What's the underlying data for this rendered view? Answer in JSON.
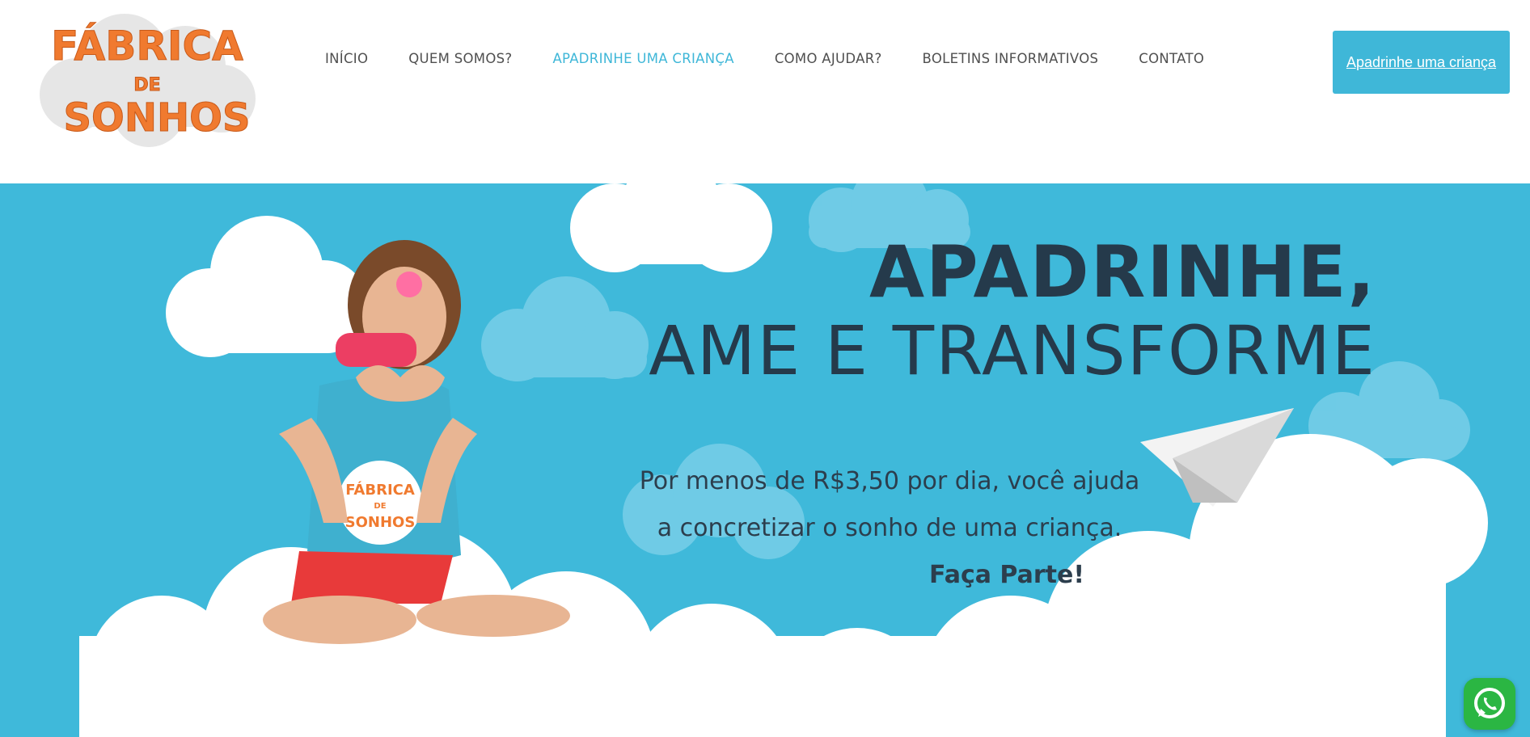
{
  "logo": {
    "line1": "FÁBRICA",
    "line2": "DE",
    "line3": "SONHOS"
  },
  "nav": {
    "items": [
      {
        "label": "INÍCIO"
      },
      {
        "label": "QUEM SOMOS?"
      },
      {
        "label": "APADRINHE UMA CRIANÇA"
      },
      {
        "label": "COMO AJUDAR?"
      },
      {
        "label": "BOLETINS INFORMATIVOS"
      },
      {
        "label": "CONTATO"
      }
    ],
    "active_index": 2
  },
  "cta_button": {
    "label": "Apadrinhe uma criança"
  },
  "hero": {
    "headline_line1": "APADRINHE,",
    "headline_line2": "AME E TRANSFORME",
    "sub_line1": "Por menos de R$3,50 por dia, você ajuda",
    "sub_line2": "a concretizar o sonho de uma criança.",
    "sub_line3": "Faça Parte!",
    "shirt_logo_line1": "FÁBRICA",
    "shirt_logo_line2": "DE",
    "shirt_logo_line3": "SONHOS"
  },
  "colors": {
    "accent": "#3fb7d8",
    "hero_bg": "#3fb9da",
    "headline": "#253a4b",
    "logo_orange": "#f07a2f",
    "whatsapp": "#2bb643"
  },
  "icons": {
    "whatsapp": "whatsapp-icon"
  }
}
